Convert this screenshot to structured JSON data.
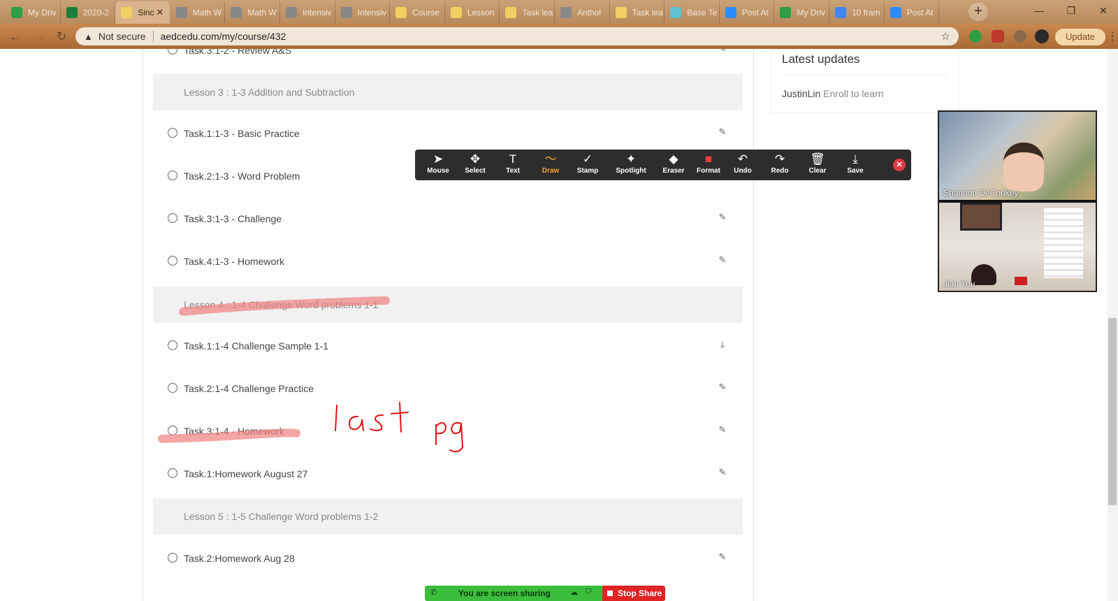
{
  "browser": {
    "tabs": [
      {
        "title": "My Driv",
        "color": "#2f9e44",
        "active": false
      },
      {
        "title": "2020-2",
        "color": "#188038",
        "active": false
      },
      {
        "title": "Sinc",
        "color": "#f0d060",
        "active": true
      },
      {
        "title": "Math W",
        "color": "#888888",
        "active": false
      },
      {
        "title": "Math W",
        "color": "#888888",
        "active": false
      },
      {
        "title": "Intensiv",
        "color": "#888888",
        "active": false
      },
      {
        "title": "Intensiv",
        "color": "#888888",
        "active": false
      },
      {
        "title": "Course",
        "color": "#f0d060",
        "active": false
      },
      {
        "title": "Lesson",
        "color": "#f0d060",
        "active": false
      },
      {
        "title": "Task lea",
        "color": "#f0d060",
        "active": false
      },
      {
        "title": "Anthol",
        "color": "#888888",
        "active": false
      },
      {
        "title": "Task lea",
        "color": "#f0d060",
        "active": false
      },
      {
        "title": "Base Te",
        "color": "#5ec1d6",
        "active": false
      },
      {
        "title": "Post At",
        "color": "#2d8cff",
        "active": false
      },
      {
        "title": "My Driv",
        "color": "#2f9e44",
        "active": false
      },
      {
        "title": "10 fram",
        "color": "#4285f4",
        "active": false
      },
      {
        "title": "Post At",
        "color": "#2d8cff",
        "active": false
      }
    ],
    "security": "Not secure",
    "url": "aedcedu.com/my/course/432",
    "update_label": "Update"
  },
  "course": {
    "partial_top": "Task.3:1-2 - Review A&S",
    "rows": [
      {
        "kind": "lesson",
        "text": "Lesson 3 : 1-3 Addition and Subtraction"
      },
      {
        "kind": "task",
        "text": "Task.1:1-3 - Basic Practice",
        "icon": "pencil-icon"
      },
      {
        "kind": "task",
        "text": "Task.2:1-3 - Word Problem",
        "icon": "pencil-icon"
      },
      {
        "kind": "task",
        "text": "Task.3:1-3 - Challenge",
        "icon": "pencil-icon"
      },
      {
        "kind": "task",
        "text": "Task.4:1-3 - Homework",
        "icon": "pencil-icon"
      },
      {
        "kind": "lesson",
        "text": "Lesson 4 : 1-4 Challenge Word problems 1-1"
      },
      {
        "kind": "task",
        "text": "Task.1:1-4 Challenge Sample 1-1",
        "icon": "download-icon"
      },
      {
        "kind": "task",
        "text": "Task.2:1-4 Challenge Practice",
        "icon": "pencil-icon"
      },
      {
        "kind": "task",
        "text": "Task.3:1-4 - Homework",
        "icon": "pencil-icon"
      },
      {
        "kind": "task",
        "text": "Task.1:Homework August 27",
        "icon": "pencil-icon"
      },
      {
        "kind": "lesson",
        "text": "Lesson 5 : 1-5 Challenge Word problems 1-2"
      },
      {
        "kind": "task",
        "text": "Task.2:Homework Aug 28",
        "icon": "pencil-icon"
      }
    ]
  },
  "sidebar": {
    "updates_title": "Latest updates",
    "update_user": "JustinLin",
    "update_text": "Enroll to learn"
  },
  "annotation_toolbar": {
    "tools": [
      {
        "label": "Mouse",
        "icon": "mouse-pointer-icon"
      },
      {
        "label": "Select",
        "icon": "move-icon"
      },
      {
        "label": "Text",
        "icon": "text-icon"
      },
      {
        "label": "Draw",
        "icon": "draw-icon"
      },
      {
        "label": "Stamp",
        "icon": "checkmark-icon"
      },
      {
        "label": "Spotlight",
        "icon": "spotlight-icon"
      },
      {
        "label": "Eraser",
        "icon": "eraser-icon"
      },
      {
        "label": "Format",
        "icon": "format-icon"
      },
      {
        "label": "Undo",
        "icon": "undo-icon"
      },
      {
        "label": "Redo",
        "icon": "redo-icon"
      },
      {
        "label": "Clear",
        "icon": "trash-icon"
      },
      {
        "label": "Save",
        "icon": "save-icon"
      }
    ],
    "active_tool": "Draw",
    "active_color": "#f5a623",
    "format_color": "#ff3b3b"
  },
  "video": {
    "participants": [
      "Shannon DeConkey",
      "Jian You"
    ]
  },
  "screen_share": {
    "status": "You are screen sharing",
    "stop_label": "Stop Share"
  },
  "annotations": {
    "handwriting": [
      "last",
      "pg"
    ],
    "ink_color": "#e01010",
    "highlight_color": "#f08080"
  }
}
